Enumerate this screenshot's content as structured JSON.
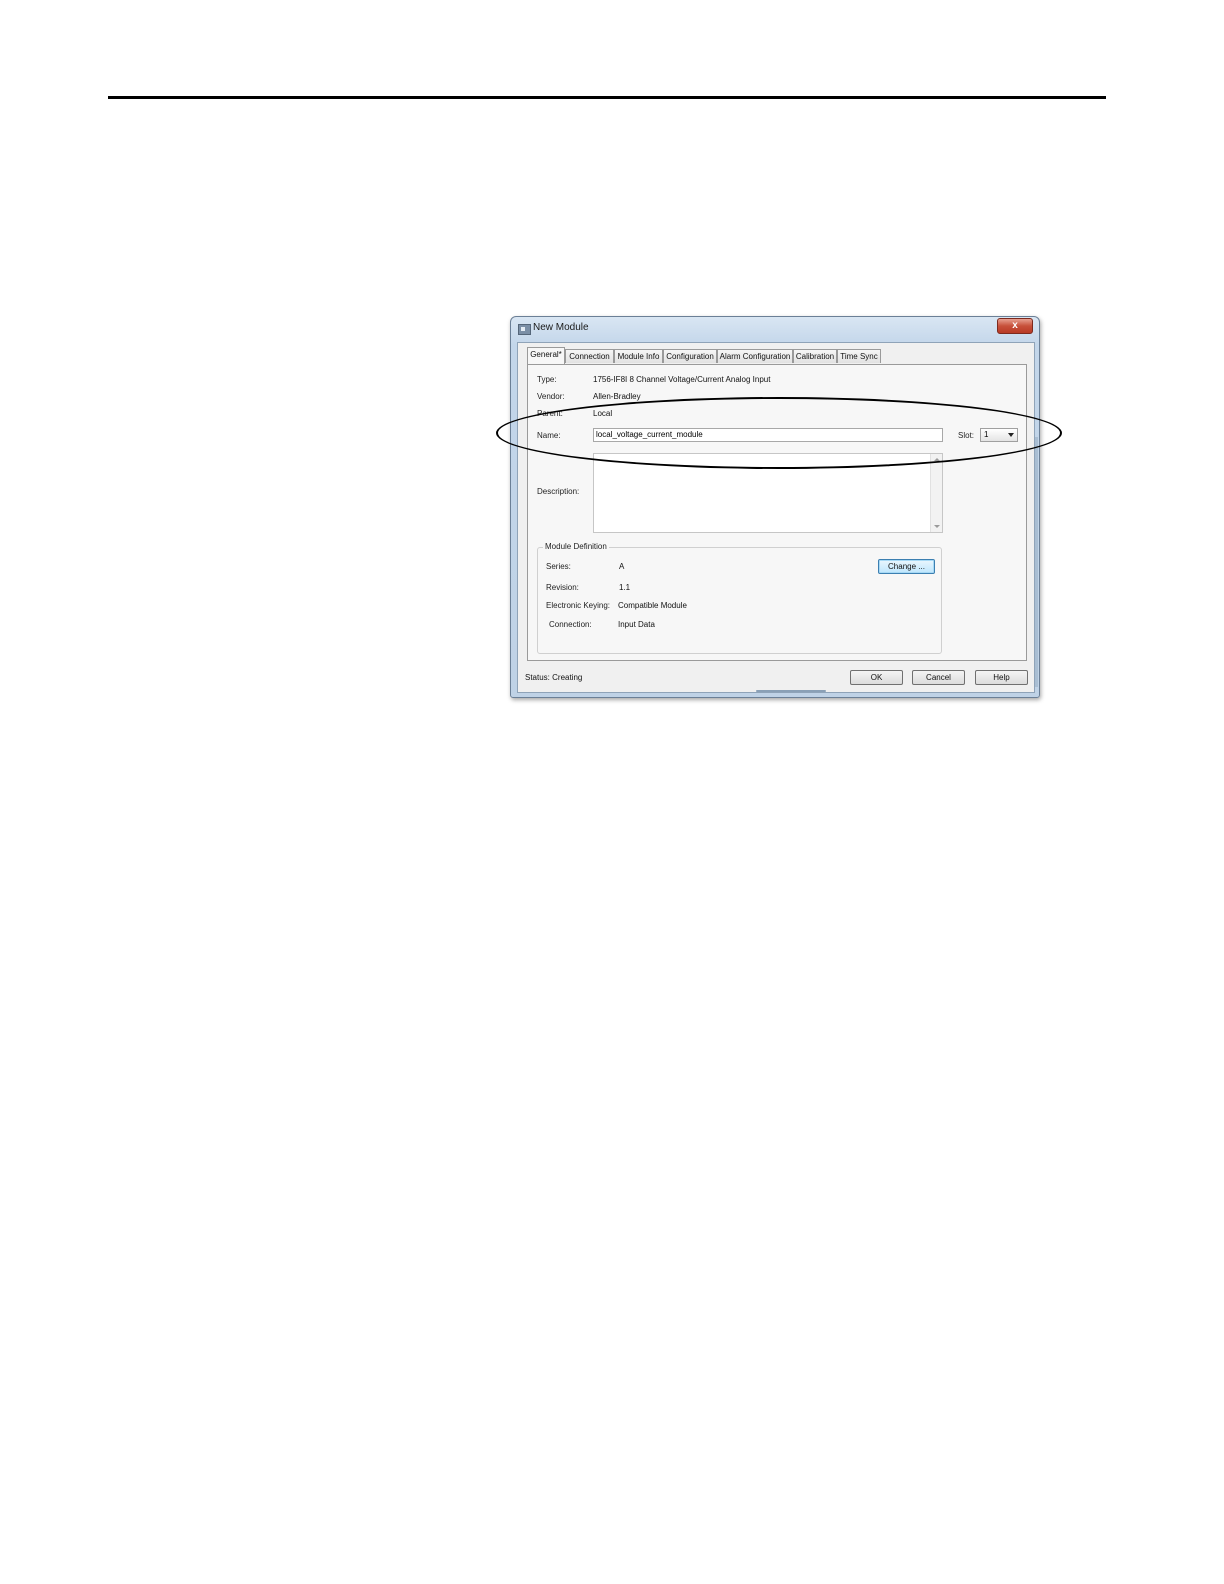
{
  "window": {
    "title": "New Module",
    "close_glyph": "x"
  },
  "tabs": [
    {
      "label": "General*"
    },
    {
      "label": "Connection"
    },
    {
      "label": "Module Info"
    },
    {
      "label": "Configuration"
    },
    {
      "label": "Alarm Configuration"
    },
    {
      "label": "Calibration"
    },
    {
      "label": "Time Sync"
    }
  ],
  "general": {
    "type_label": "Type:",
    "type_value": "1756-IF8I 8 Channel Voltage/Current Analog Input",
    "vendor_label": "Vendor:",
    "vendor_value": "Allen-Bradley",
    "parent_label": "Parent:",
    "parent_value": "Local",
    "name_label": "Name:",
    "name_value": "local_voltage_current_module",
    "slot_label": "Slot:",
    "slot_value": "1",
    "description_label": "Description:",
    "description_value": ""
  },
  "module_definition": {
    "legend": "Module Definition",
    "series_label": "Series:",
    "series_value": "A",
    "revision_label": "Revision:",
    "revision_value": "1.1",
    "keying_label": "Electronic Keying:",
    "keying_value": "Compatible Module",
    "connection_label": "Connection:",
    "connection_value": "Input Data",
    "change_button": "Change ..."
  },
  "footer": {
    "status_text": "Status:  Creating",
    "ok_button": "OK",
    "cancel_button": "Cancel",
    "help_button": "Help"
  }
}
